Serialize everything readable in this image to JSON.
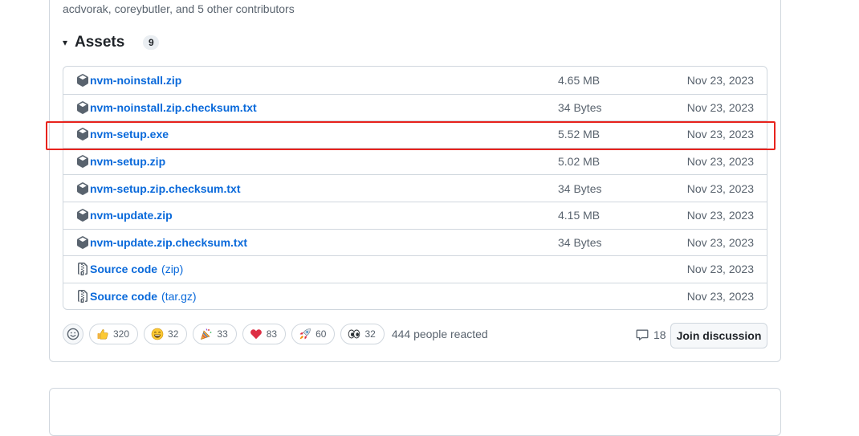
{
  "release": {
    "contributors_text": "acdvorak, coreybutler, and 5 other contributors",
    "assets": {
      "caret": "▾",
      "title": "Assets",
      "count": "9",
      "items": [
        {
          "name": "nvm-noinstall.zip",
          "suffix": "",
          "size": "4.65 MB",
          "date": "Nov 23, 2023",
          "icon": "package-icon"
        },
        {
          "name": "nvm-noinstall.zip.checksum.txt",
          "suffix": "",
          "size": "34 Bytes",
          "date": "Nov 23, 2023",
          "icon": "package-icon"
        },
        {
          "name": "nvm-setup.exe",
          "suffix": "",
          "size": "5.52 MB",
          "date": "Nov 23, 2023",
          "icon": "package-icon"
        },
        {
          "name": "nvm-setup.zip",
          "suffix": "",
          "size": "5.02 MB",
          "date": "Nov 23, 2023",
          "icon": "package-icon"
        },
        {
          "name": "nvm-setup.zip.checksum.txt",
          "suffix": "",
          "size": "34 Bytes",
          "date": "Nov 23, 2023",
          "icon": "package-icon"
        },
        {
          "name": "nvm-update.zip",
          "suffix": "",
          "size": "4.15 MB",
          "date": "Nov 23, 2023",
          "icon": "package-icon"
        },
        {
          "name": "nvm-update.zip.checksum.txt",
          "suffix": "",
          "size": "34 Bytes",
          "date": "Nov 23, 2023",
          "icon": "package-icon"
        },
        {
          "name": "Source code",
          "suffix": "(zip)",
          "size": "",
          "date": "Nov 23, 2023",
          "icon": "file-zip-icon"
        },
        {
          "name": "Source code",
          "suffix": "(tar.gz)",
          "size": "",
          "date": "Nov 23, 2023",
          "icon": "file-zip-icon"
        }
      ]
    },
    "reactions": {
      "items": [
        {
          "emoji": "thumbs-up",
          "count": "320"
        },
        {
          "emoji": "laugh",
          "count": "32"
        },
        {
          "emoji": "hooray",
          "count": "33"
        },
        {
          "emoji": "heart",
          "count": "83"
        },
        {
          "emoji": "rocket",
          "count": "60"
        },
        {
          "emoji": "eyes",
          "count": "32"
        }
      ],
      "summary": "444 people reacted"
    },
    "comments_count": "18",
    "join_label": "Join discussion"
  },
  "highlight_color": "#e8231d",
  "link_color": "#0969da"
}
